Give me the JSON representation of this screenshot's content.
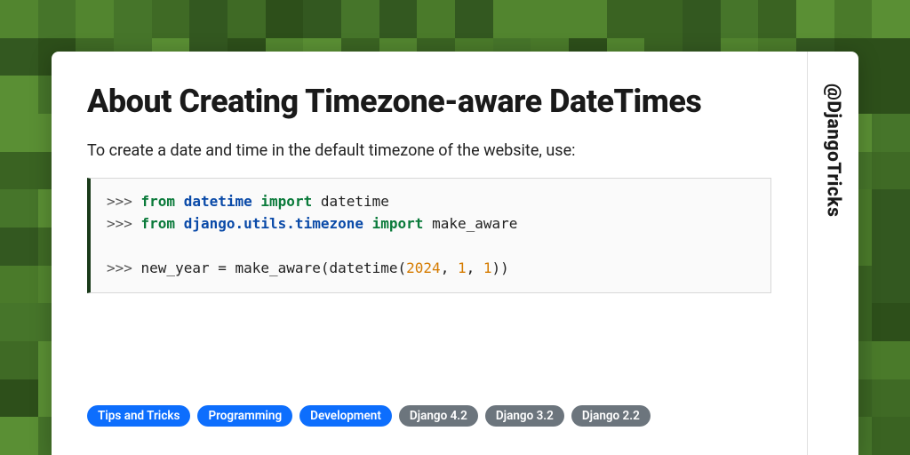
{
  "title": "About Creating Timezone-aware DateTimes",
  "description": "To create a date and time in the default timezone of the website, use:",
  "handle": "@DjangoTricks",
  "code": {
    "line1": {
      "prompt": ">>> ",
      "kw1": "from",
      "mod1": "datetime",
      "kw2": "import",
      "name": "datetime"
    },
    "line2": {
      "prompt": ">>> ",
      "kw1": "from",
      "mod1": "django.utils.timezone",
      "kw2": "import",
      "name": "make_aware"
    },
    "line3": {
      "prompt": ">>> ",
      "text1": "new_year = make_aware(datetime(",
      "n1": "2024",
      "c1": ", ",
      "n2": "1",
      "c2": ", ",
      "n3": "1",
      "text2": "))"
    }
  },
  "tags": [
    {
      "label": "Tips and Tricks",
      "color": "blue"
    },
    {
      "label": "Programming",
      "color": "blue"
    },
    {
      "label": "Development",
      "color": "blue"
    },
    {
      "label": "Django 4.2",
      "color": "gray"
    },
    {
      "label": "Django 3.2",
      "color": "gray"
    },
    {
      "label": "Django 2.2",
      "color": "gray"
    }
  ],
  "bg_palette": [
    "#2d4f1a",
    "#3a6322",
    "#4a7a2a",
    "#5a8f34",
    "#3f6a25",
    "#335820",
    "#46752a",
    "#52852f"
  ]
}
